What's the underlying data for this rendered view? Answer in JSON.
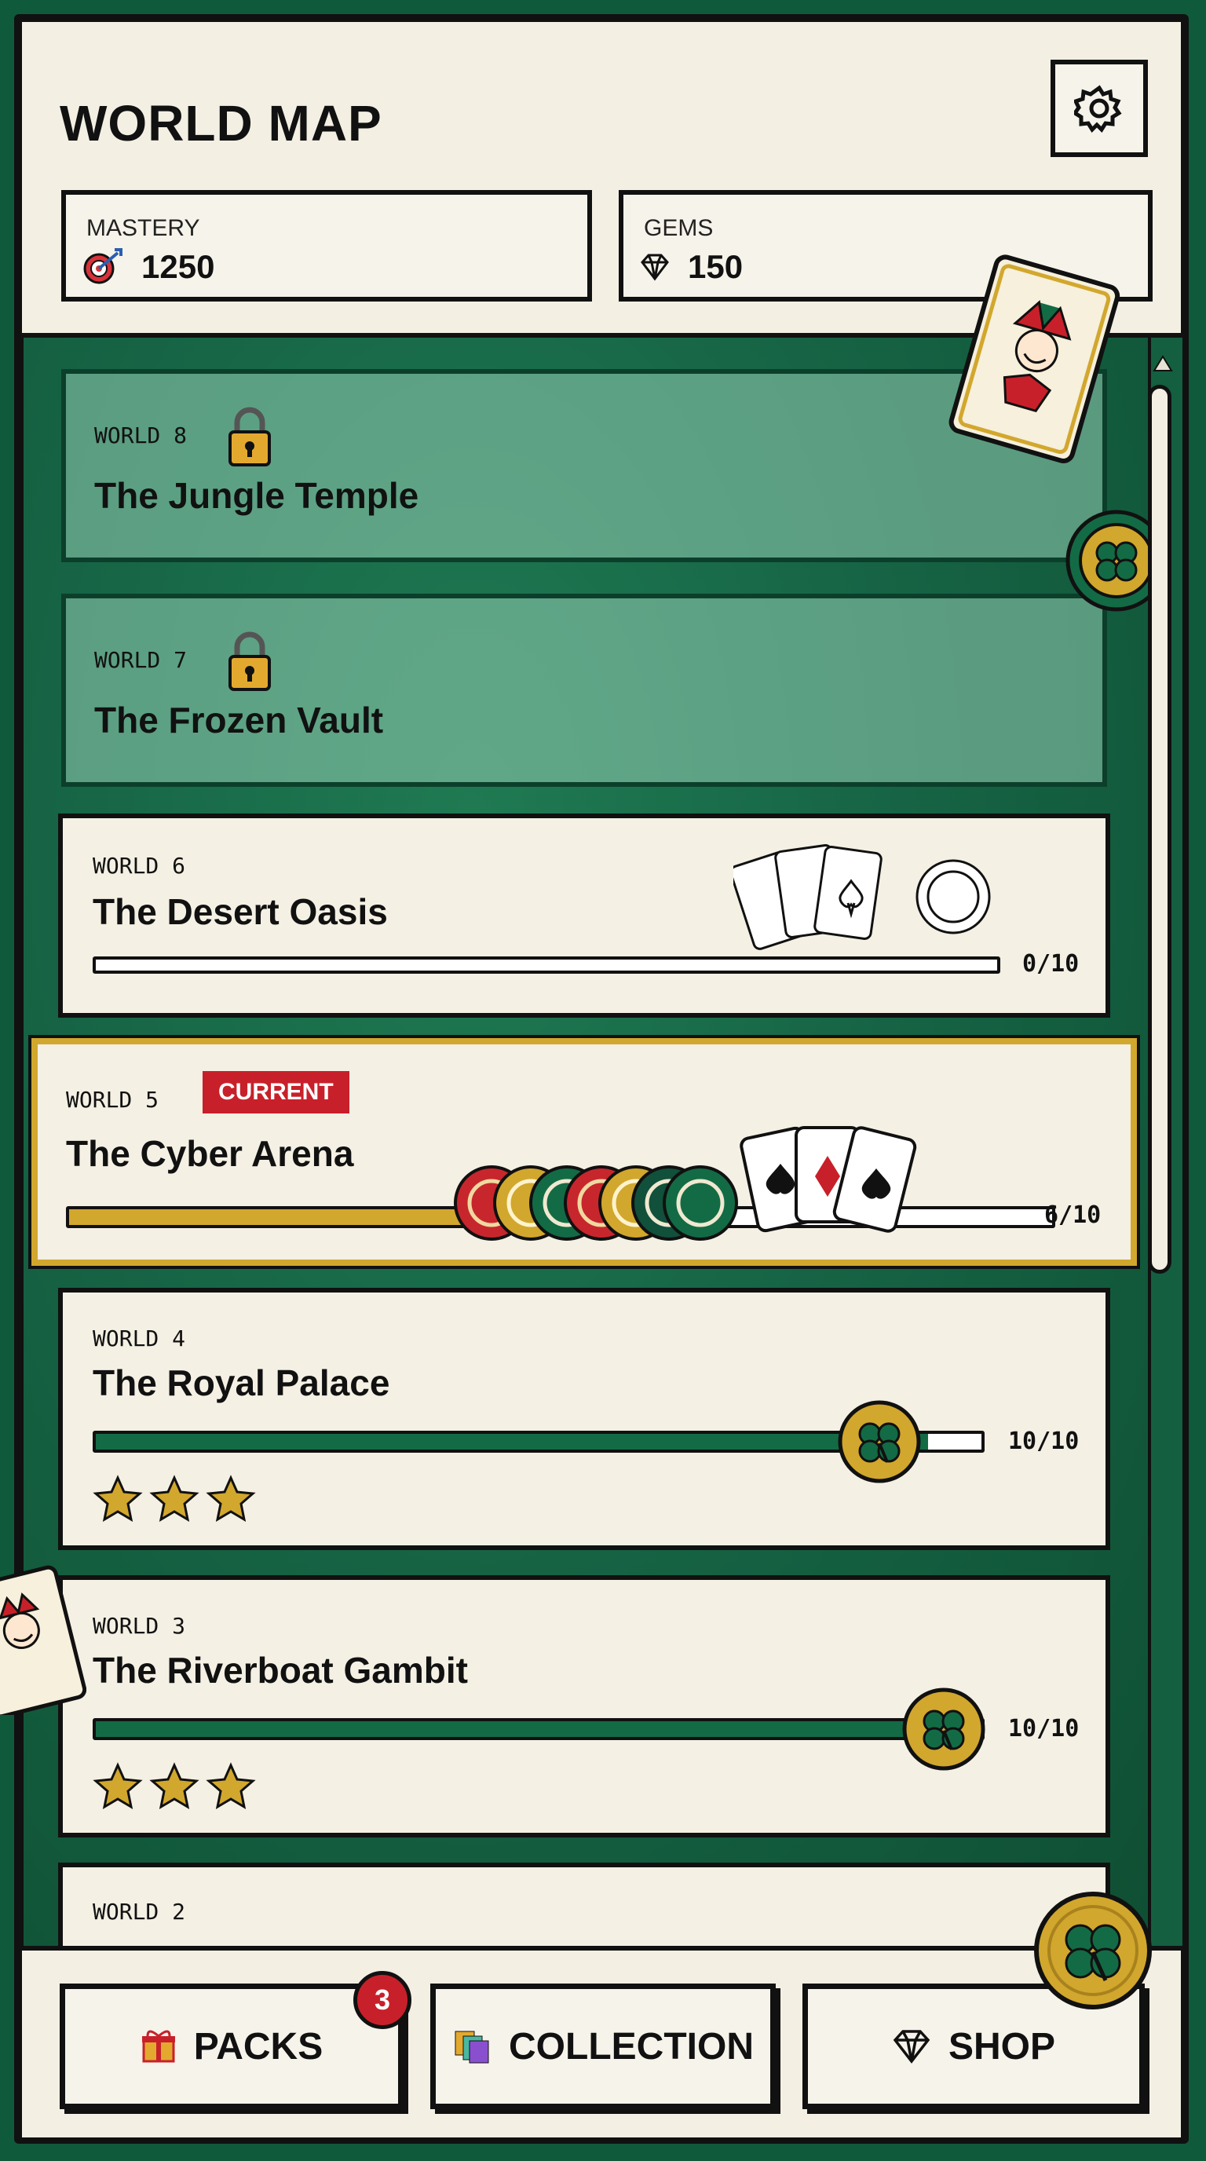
{
  "header": {
    "title": "WORLD MAP",
    "settings_icon": "gear-icon",
    "mastery": {
      "label": "MASTERY",
      "value": "1250",
      "icon": "target-icon"
    },
    "gems": {
      "label": "GEMS",
      "value": "150",
      "icon": "gem-icon"
    }
  },
  "worlds": [
    {
      "label": "WORLD 8",
      "name": "The Jungle Temple",
      "state": "locked"
    },
    {
      "label": "WORLD 7",
      "name": "The Frozen Vault",
      "state": "locked"
    },
    {
      "label": "WORLD 6",
      "name": "The Desert Oasis",
      "state": "open",
      "progress": "0/10",
      "fraction": 0
    },
    {
      "label": "WORLD 5",
      "name": "The Cyber Arena",
      "state": "current",
      "badge": "CURRENT",
      "progress": "6/10",
      "fraction": 0.6
    },
    {
      "label": "WORLD 4",
      "name": "The Royal Palace",
      "state": "complete",
      "progress": "10/10",
      "fraction": 1,
      "stars": 3
    },
    {
      "label": "WORLD 3",
      "name": "The Riverboat Gambit",
      "state": "complete",
      "progress": "10/10",
      "fraction": 1,
      "stars": 3
    },
    {
      "label": "WORLD 2",
      "name": "",
      "state": "partially-visible"
    }
  ],
  "footer": {
    "packs": {
      "label": "PACKS",
      "badge": "3",
      "icon": "gift-icon"
    },
    "collection": {
      "label": "COLLECTION",
      "icon": "cards-icon"
    },
    "shop": {
      "label": "SHOP",
      "icon": "gem-icon"
    }
  },
  "decorations": {
    "joker_card_text": "JOKER"
  },
  "colors": {
    "felt": "#166445",
    "panel": "#f3efe3",
    "gold": "#d2a72d",
    "green_fill": "#136b45",
    "gold_fill": "#d2a72d",
    "red_badge": "#c8202a"
  }
}
